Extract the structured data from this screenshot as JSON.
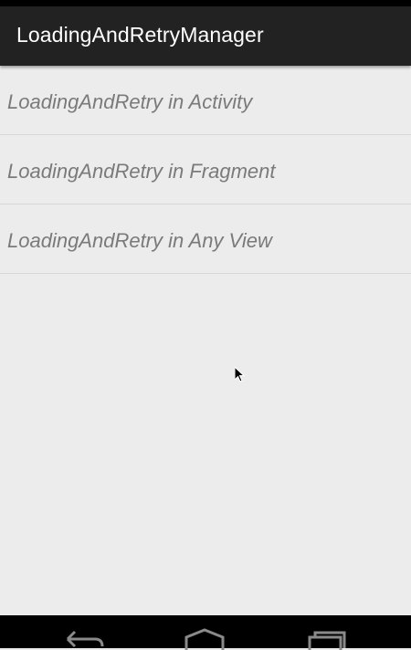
{
  "app": {
    "title": "LoadingAndRetryManager"
  },
  "list": {
    "items": [
      {
        "label": "LoadingAndRetry in Activity"
      },
      {
        "label": "LoadingAndRetry in Fragment"
      },
      {
        "label": "LoadingAndRetry in Any View"
      }
    ]
  },
  "navigation": {
    "buttons": [
      {
        "icon": "back-icon"
      },
      {
        "icon": "home-icon"
      },
      {
        "icon": "recent-apps-icon"
      }
    ]
  },
  "colors": {
    "action_bar": "#222222",
    "background": "#ececec",
    "item_text": "#7a7a7a"
  }
}
